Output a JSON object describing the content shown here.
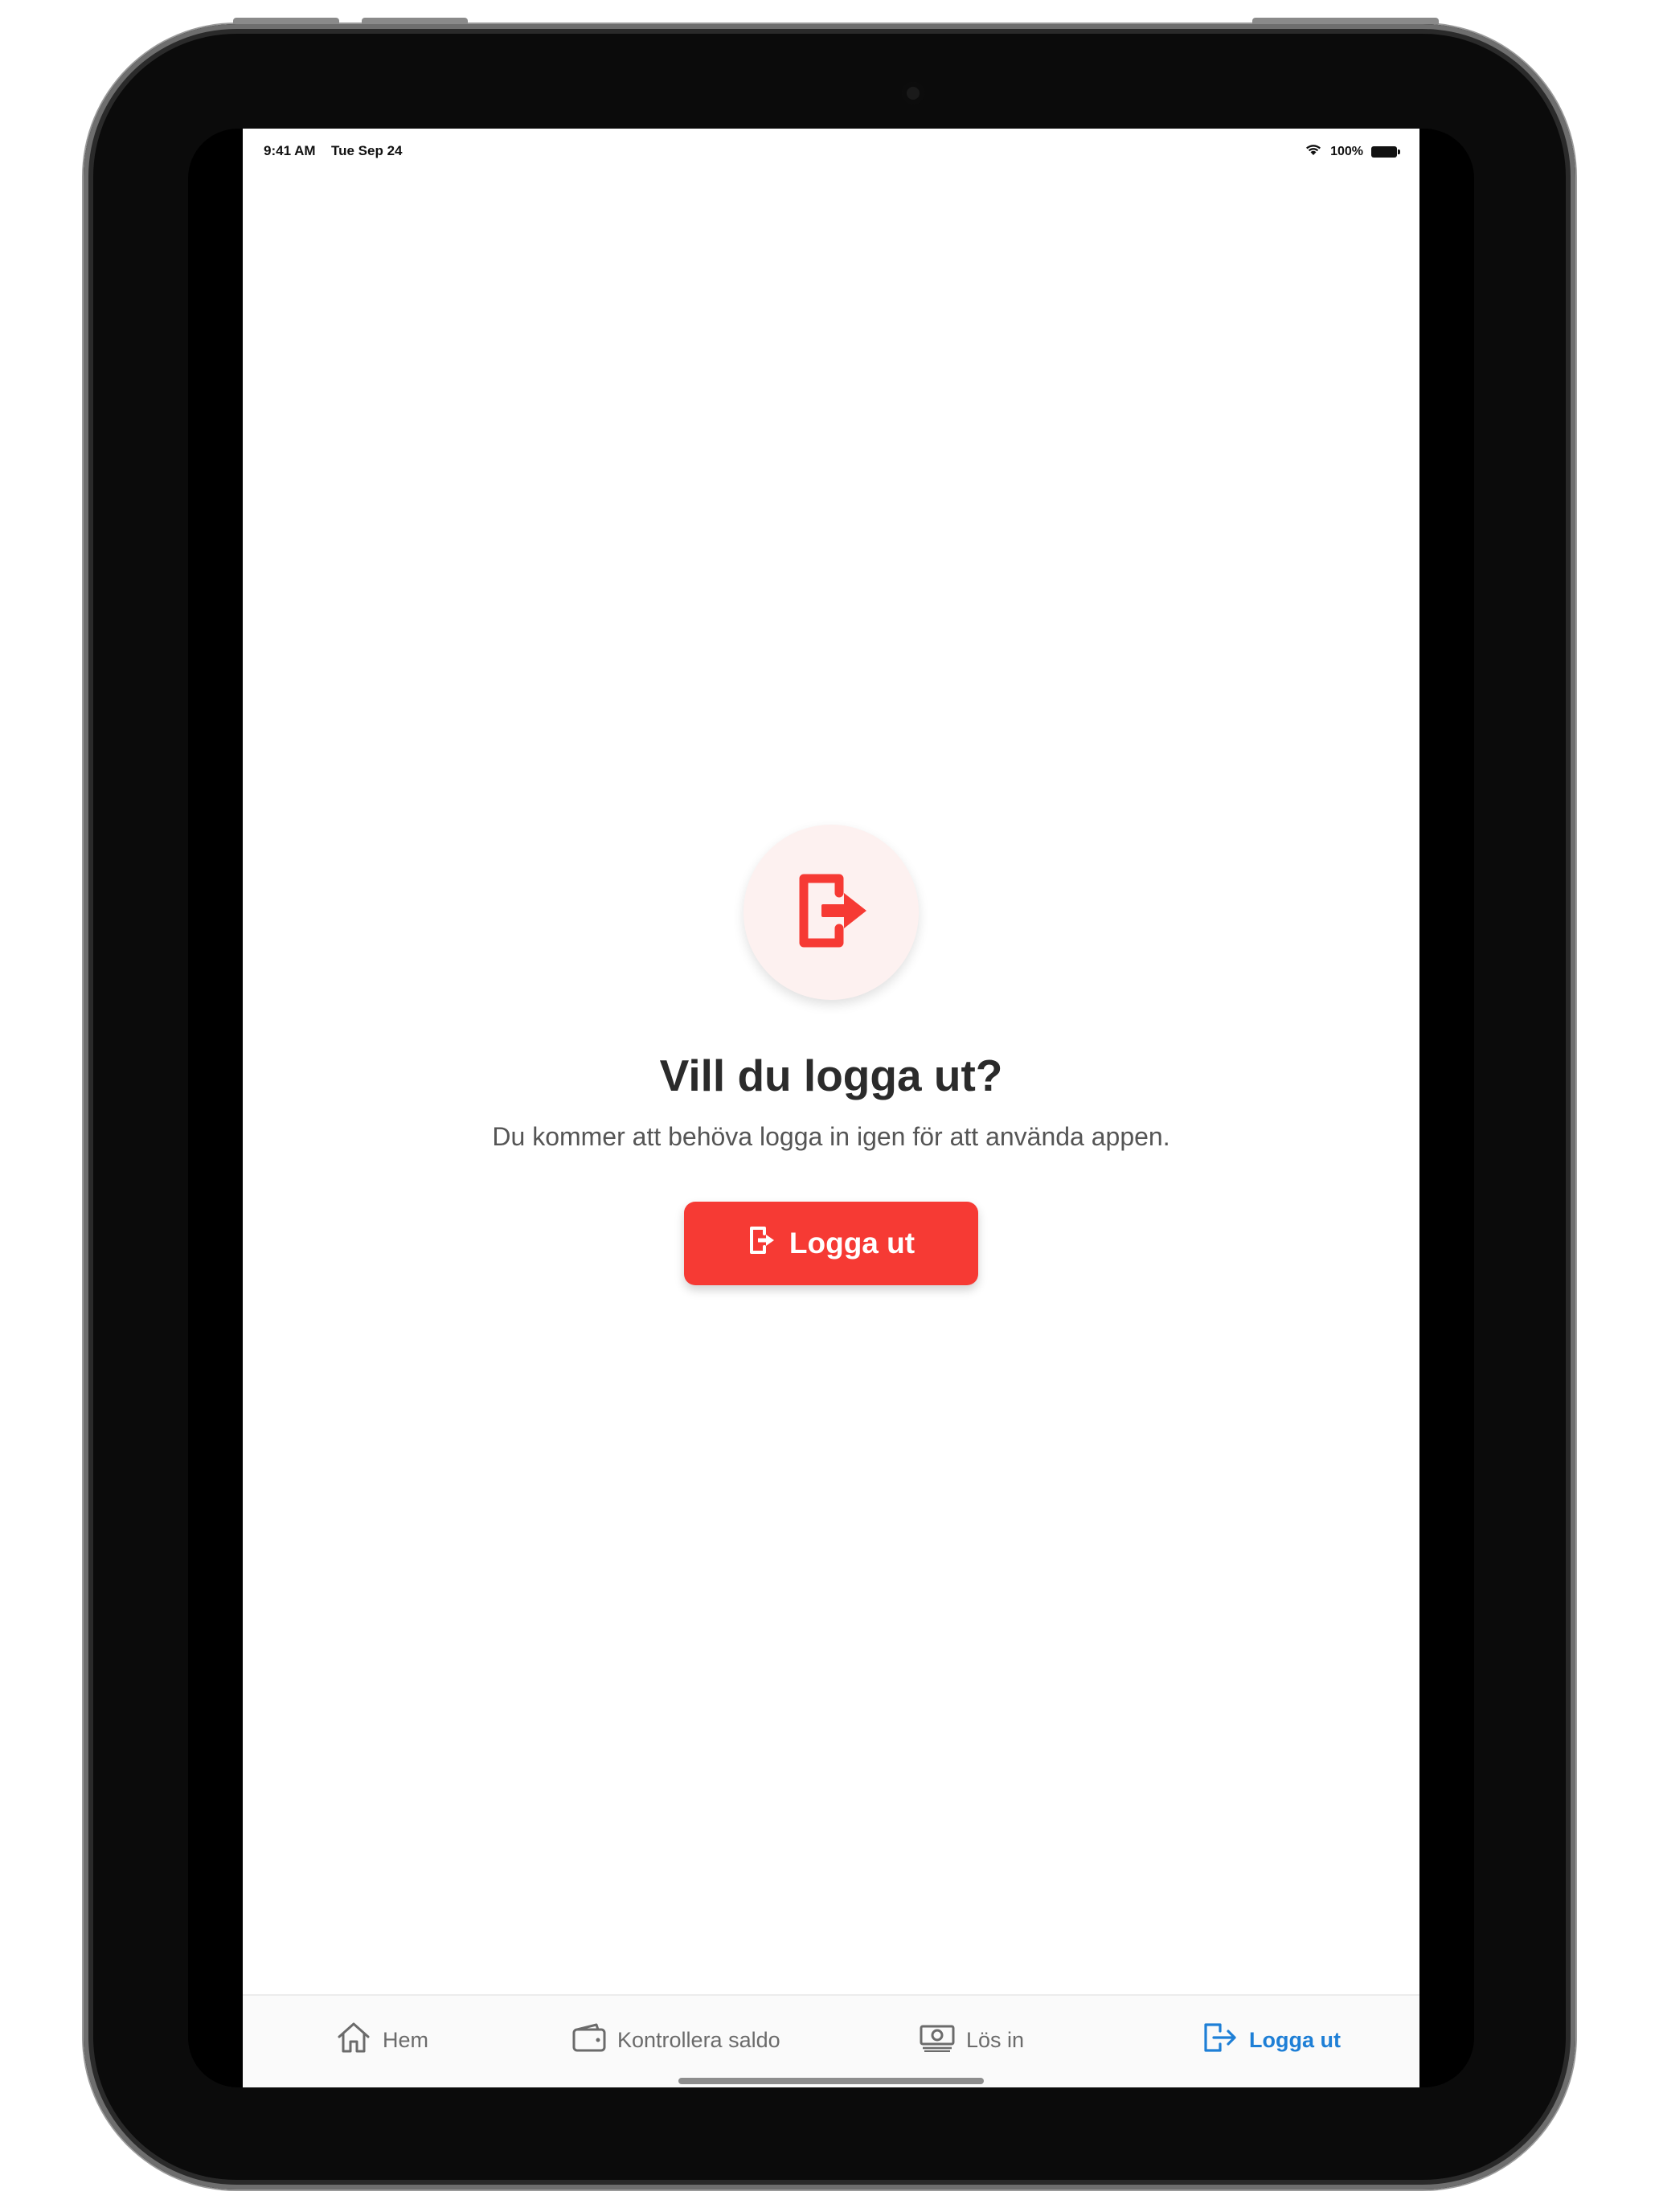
{
  "status_bar": {
    "time": "9:41 AM",
    "date": "Tue Sep 24",
    "battery": "100%"
  },
  "dialog": {
    "icon": "logout-icon",
    "title": "Vill du logga ut?",
    "message": "Du kommer att behöva logga in igen för att använda appen.",
    "button_label": "Logga ut"
  },
  "tabs": [
    {
      "label": "Hem",
      "icon": "home-icon",
      "active": false
    },
    {
      "label": "Kontrollera saldo",
      "icon": "wallet-icon",
      "active": false
    },
    {
      "label": "Lös in",
      "icon": "cash-icon",
      "active": false
    },
    {
      "label": "Logga ut",
      "icon": "logout-icon",
      "active": true
    }
  ],
  "colors": {
    "accent_red": "#f63a34",
    "active_tab_blue": "#1e7fd6"
  }
}
